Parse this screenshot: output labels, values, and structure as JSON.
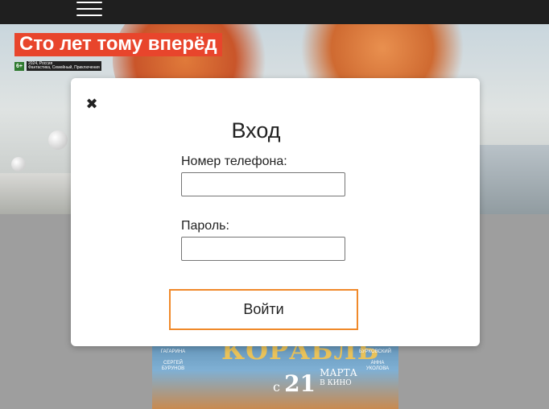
{
  "header": {
    "menu_icon": "hamburger-menu-icon"
  },
  "hero": {
    "title": "Сто лет тому вперёд",
    "age_rating": "6+",
    "info_line1": "2024, Россия",
    "info_line2": "Фантастика, Семейный, Приключения"
  },
  "poster": {
    "title": "КОРАБЛЬ",
    "left_names": [
      "ГАГАРИНА",
      "СЕРГЕЙ БУРУНОВ"
    ],
    "right_names": [
      "БУРКОВСКИЙ",
      "АННА УКОЛОВА"
    ],
    "release_prefix": "с",
    "release_day": "21",
    "release_month": "МАРТА",
    "release_suffix": "В КИНО"
  },
  "modal": {
    "close_icon": "close-icon",
    "close_glyph": "✖",
    "title": "Вход",
    "phone_label": "Номер телефона:",
    "phone_value": "",
    "password_label": "Пароль:",
    "password_value": "",
    "submit_label": "Войти",
    "accent_color": "#f0892a"
  }
}
